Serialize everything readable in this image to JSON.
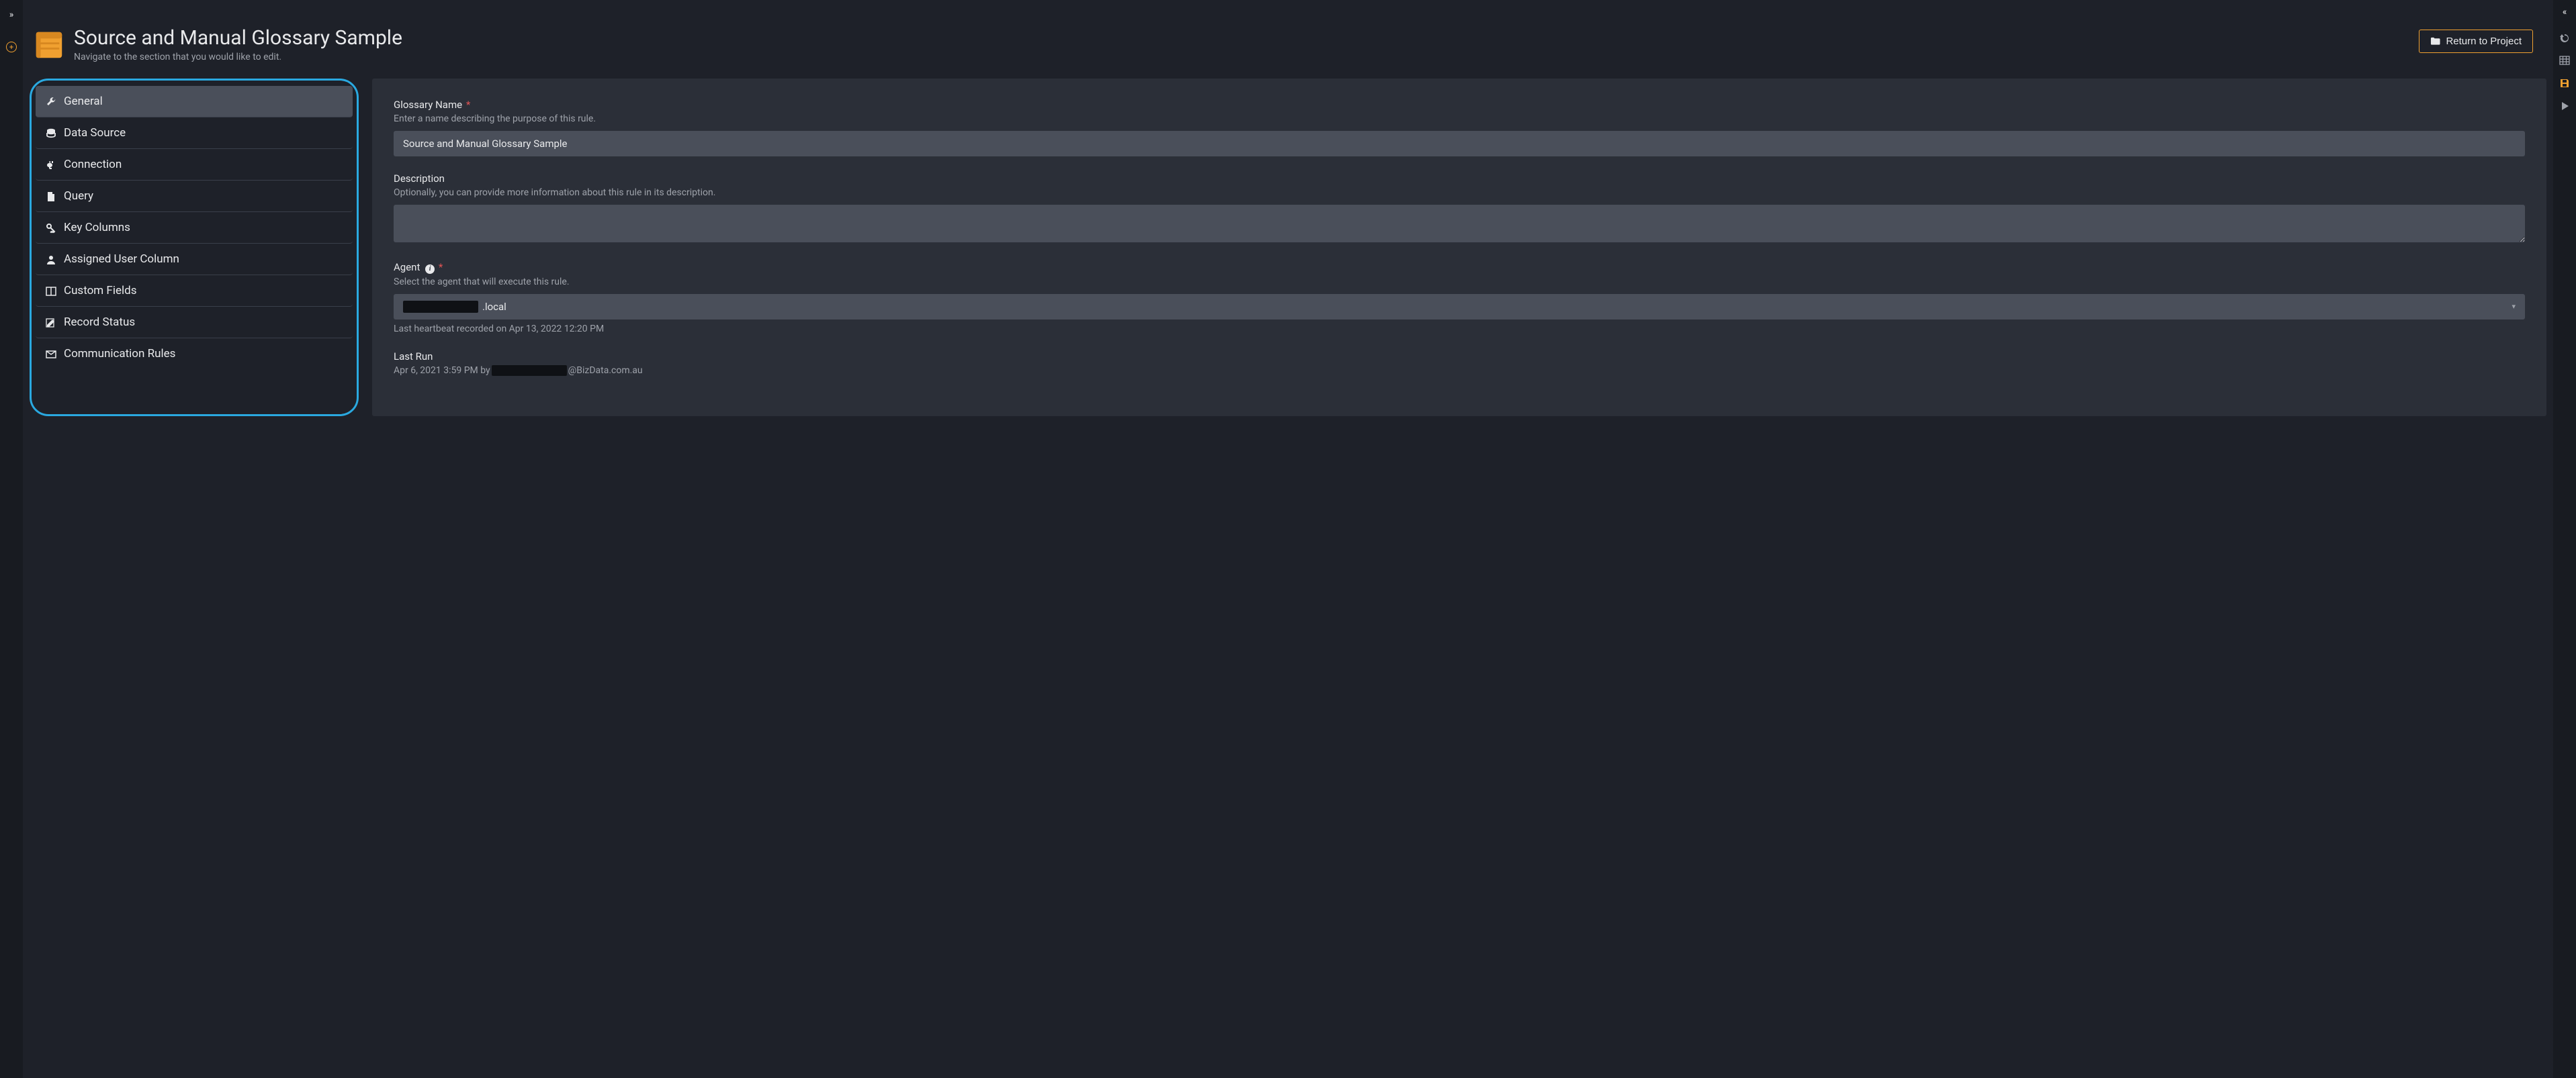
{
  "header": {
    "title": "Source and Manual Glossary Sample",
    "subtitle": "Navigate to the section that you would like to edit.",
    "return_label": "Return to Project"
  },
  "nav": {
    "items": [
      {
        "label": "General",
        "icon": "wrench-icon",
        "active": true
      },
      {
        "label": "Data Source",
        "icon": "database-icon",
        "active": false
      },
      {
        "label": "Connection",
        "icon": "plug-icon",
        "active": false
      },
      {
        "label": "Query",
        "icon": "file-icon",
        "active": false
      },
      {
        "label": "Key Columns",
        "icon": "key-icon",
        "active": false
      },
      {
        "label": "Assigned User Column",
        "icon": "user-icon",
        "active": false
      },
      {
        "label": "Custom Fields",
        "icon": "columns-icon",
        "active": false
      },
      {
        "label": "Record Status",
        "icon": "edit-icon",
        "active": false
      },
      {
        "label": "Communication Rules",
        "icon": "envelope-icon",
        "active": false
      }
    ]
  },
  "form": {
    "glossary_name": {
      "label": "Glossary Name",
      "required": true,
      "help": "Enter a name describing the purpose of this rule.",
      "value": "Source and Manual Glossary Sample"
    },
    "description": {
      "label": "Description",
      "help": "Optionally, you can provide more information about this rule in its description.",
      "value": ""
    },
    "agent": {
      "label": "Agent",
      "required": true,
      "help": "Select the agent that will execute this rule.",
      "selected_suffix": ".local",
      "heartbeat_prefix": "Last heartbeat recorded on ",
      "heartbeat_time": "Apr 13, 2022 12:20 PM"
    },
    "last_run": {
      "label": "Last Run",
      "time_by": "Apr 6, 2021 3:59 PM by ",
      "domain": "@BizData.com.au"
    }
  }
}
